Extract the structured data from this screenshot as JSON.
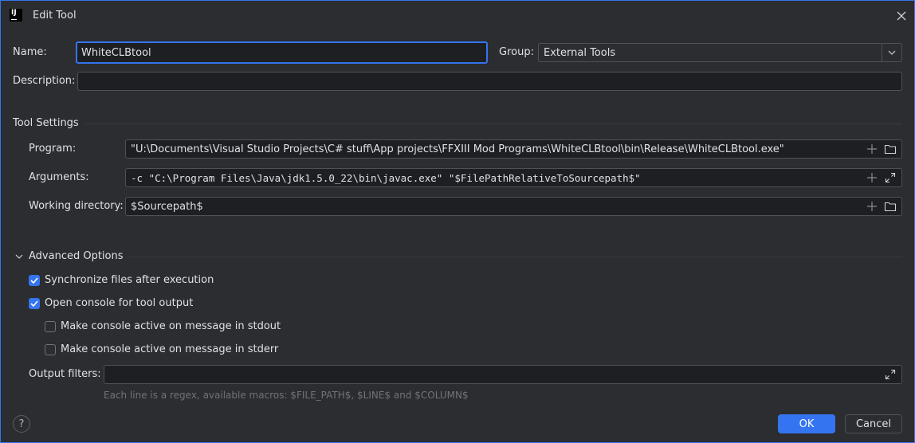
{
  "window": {
    "title": "Edit Tool",
    "logo_text": "IJ"
  },
  "name": {
    "label": "Name:",
    "value": "WhiteCLBtool"
  },
  "group": {
    "label": "Group:",
    "value": "External Tools"
  },
  "description": {
    "label": "Description:",
    "value": ""
  },
  "tool_settings": {
    "heading": "Tool Settings",
    "program": {
      "label": "Program:",
      "value": "\"U:\\Documents\\Visual Studio Projects\\C# stuff\\App projects\\FFXIII Mod Programs\\WhiteCLBtool\\bin\\Release\\WhiteCLBtool.exe\""
    },
    "arguments": {
      "label": "Arguments:",
      "value": "-c \"C:\\Program Files\\Java\\jdk1.5.0_22\\bin\\javac.exe\" \"$FilePathRelativeToSourcepath$\""
    },
    "working_directory": {
      "label": "Working directory:",
      "value": "$Sourcepath$"
    }
  },
  "advanced": {
    "heading": "Advanced Options",
    "sync_files": {
      "label": "Synchronize files after execution",
      "checked": true
    },
    "open_console": {
      "label": "Open console for tool output",
      "checked": true
    },
    "console_stdout": {
      "label": "Make console active on message in stdout",
      "checked": false
    },
    "console_stderr": {
      "label": "Make console active on message in stderr",
      "checked": false
    },
    "output_filters": {
      "label": "Output filters:",
      "value": "",
      "hint": "Each line is a regex, available macros: $FILE_PATH$, $LINE$ and $COLUMN$"
    }
  },
  "buttons": {
    "ok": "OK",
    "cancel": "Cancel",
    "help": "?"
  },
  "colors": {
    "background": "#2b2d30",
    "accent": "#3574f0",
    "field": "#1e1f22",
    "border": "#4e5157",
    "text": "#dfe1e5"
  },
  "icons": {
    "close": "close-icon",
    "add": "plus-icon",
    "folder": "folder-icon",
    "expand": "expand-icon",
    "collapse": "chevron-down-icon",
    "check": "check-icon"
  }
}
